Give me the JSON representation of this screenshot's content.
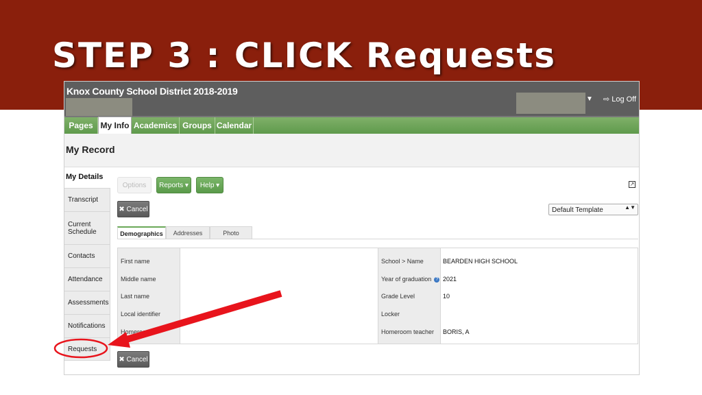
{
  "slide": {
    "title": "STEP 3 :  CLICK  Requests"
  },
  "app": {
    "district_title": "Knox County School District 2018-2019",
    "log_off": "Log Off",
    "dropdown_caret": "▼",
    "logoff_icon": "⇨"
  },
  "tabs": [
    "Pages",
    "My Info",
    "Academics",
    "Groups",
    "Calendar"
  ],
  "active_tab": "My Info",
  "page": {
    "heading": "My Record"
  },
  "sidebar": {
    "heading": "My Details",
    "items": [
      "Transcript",
      "Current Schedule",
      "Contacts",
      "Attendance",
      "Assessments",
      "Notifications",
      "Requests"
    ]
  },
  "toolbar": {
    "options": "Options",
    "reports": "Reports ▾",
    "help": "Help ▾",
    "cancel": "✖ Cancel",
    "template": "Default Template",
    "template_arrows": "▲▼",
    "popout_icon": "↗"
  },
  "subtabs": [
    "Demographics",
    "Addresses",
    "Photo"
  ],
  "form": {
    "left_labels": [
      "First name",
      "Middle name",
      "Last name",
      "Local identifier",
      "Homeroom"
    ],
    "right_labels": [
      "School > Name",
      "Year of graduation",
      "Grade Level",
      "Locker",
      "Homeroom teacher"
    ],
    "right_values": [
      "BEARDEN HIGH SCHOOL",
      "2021",
      "10",
      "",
      "BORIS, A"
    ],
    "help_mark": "?"
  },
  "colors": {
    "banner": "#8a1f0c",
    "tab_green": "#6aa857",
    "annotation_red": "#e8141c"
  }
}
